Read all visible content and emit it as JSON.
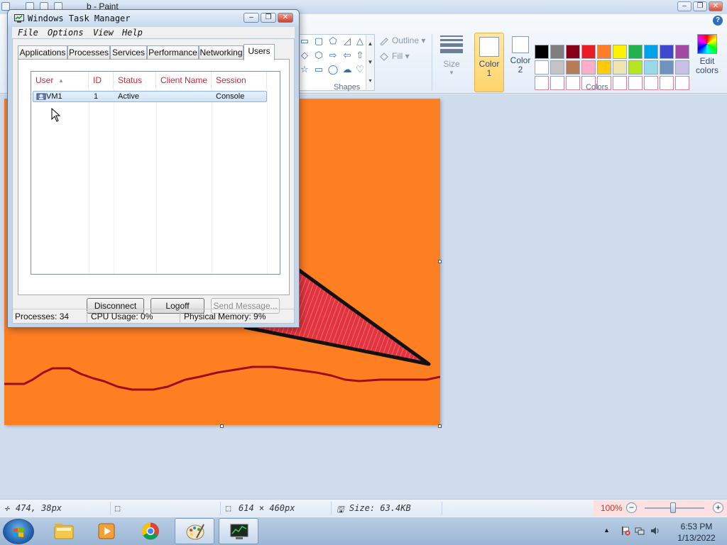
{
  "paint": {
    "title": "b - Paint",
    "ribbon": {
      "groups": {
        "shapes": "Shapes",
        "colors": "Colors"
      },
      "outline_label": "Outline",
      "fill_label": "Fill",
      "size_label": "Size",
      "color1_label": "Color 1",
      "color2_label": "Color 2",
      "edit_colors_label": "Edit colors",
      "palette_row1": [
        "#000000",
        "#7f7f7f",
        "#880015",
        "#ed1c24",
        "#ff7f27",
        "#fff200",
        "#22b14c",
        "#00a2e8",
        "#3f48cc",
        "#a349a4"
      ],
      "palette_row2": [
        "#ffffff",
        "#c3c3c3",
        "#b97a57",
        "#ffaec9",
        "#ffc90e",
        "#efe4b0",
        "#b5e61d",
        "#99d9ea",
        "#7092be",
        "#c8bfe7"
      ],
      "palette_row3_empty_count": 10
    },
    "canvas": {
      "background": "#fe7e22"
    },
    "status": {
      "cursor_pos": "474, 38px",
      "canvas_size": "614 × 460px",
      "file_size": "Size: 63.4KB",
      "zoom": "100%"
    }
  },
  "taskmgr": {
    "title": "Windows Task Manager",
    "menu": [
      "File",
      "Options",
      "View",
      "Help"
    ],
    "tabs": [
      "Applications",
      "Processes",
      "Services",
      "Performance",
      "Networking",
      "Users"
    ],
    "active_tab": "Users",
    "columns": [
      "User",
      "ID",
      "Status",
      "Client Name",
      "Session"
    ],
    "rows": [
      {
        "user": "VM1",
        "id": "1",
        "status": "Active",
        "client": "",
        "session": "Console"
      }
    ],
    "buttons": {
      "disconnect": "Disconnect",
      "logoff": "Logoff",
      "send_message": "Send Message..."
    },
    "statusbar": {
      "processes": "Processes: 34",
      "cpu": "CPU Usage: 0%",
      "memory": "Physical Memory: 9%"
    }
  },
  "taskbar": {
    "pinned": [
      "file-explorer",
      "media-player",
      "chrome",
      "paint",
      "task-manager"
    ],
    "clock_time": "6:53 PM",
    "clock_date": "1/13/2022"
  }
}
